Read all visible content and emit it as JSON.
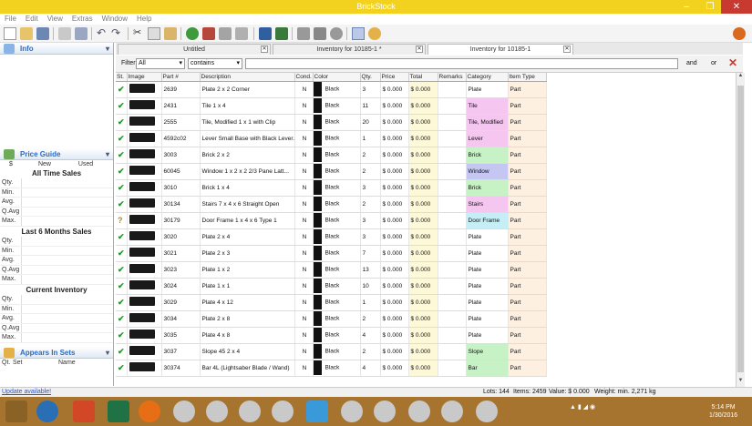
{
  "window": {
    "title": "BrickStock"
  },
  "menu": [
    "File",
    "Edit",
    "View",
    "Extras",
    "Window",
    "Help"
  ],
  "sidebar": {
    "info_title": "Info",
    "price_guide_title": "Price Guide",
    "price_cols": [
      "$",
      "New",
      "Used"
    ],
    "sections": [
      {
        "title": "All Time Sales",
        "rows": [
          "Qty.",
          "Min.",
          "Avg.",
          "Q.Avg",
          "Max."
        ]
      },
      {
        "title": "Last 6 Months Sales",
        "rows": [
          "Qty.",
          "Min.",
          "Avg.",
          "Q.Avg",
          "Max."
        ]
      },
      {
        "title": "Current Inventory",
        "rows": [
          "Qty.",
          "Min.",
          "Avg.",
          "Q.Avg",
          "Max."
        ]
      }
    ],
    "appears_title": "Appears In Sets",
    "appears_cols": [
      "Qt.",
      "Set",
      "Name"
    ]
  },
  "tabs": [
    {
      "label": "Untitled"
    },
    {
      "label": "Inventory for 10185-1 *"
    },
    {
      "label": "Inventory for 10185-1"
    }
  ],
  "filter": {
    "label": "Filter:",
    "field": "All",
    "mode": "contains",
    "value": "",
    "and": "and",
    "or": "or"
  },
  "columns": [
    "St.",
    "Image",
    "Part #",
    "Description",
    "Cond.",
    "Color",
    "Qty.",
    "Price",
    "Total",
    "Remarks",
    "Category",
    "Item Type"
  ],
  "rows": [
    {
      "status": "✔",
      "part": "2639",
      "desc": "Plate 2 x 2 Corner",
      "cond": "N",
      "color": "Black",
      "qty": "3",
      "price": "$ 0.000",
      "total": "$ 0.000",
      "category": "Plate",
      "cat_color": "#ffffff",
      "type": "Part"
    },
    {
      "status": "✔",
      "part": "2431",
      "desc": "Tile 1 x 4",
      "cond": "N",
      "color": "Black",
      "qty": "11",
      "price": "$ 0.000",
      "total": "$ 0.000",
      "category": "Tile",
      "cat_color": "#f4c6f0",
      "type": "Part"
    },
    {
      "status": "✔",
      "part": "2555",
      "desc": "Tile, Modified 1 x 1 with Clip",
      "cond": "N",
      "color": "Black",
      "qty": "20",
      "price": "$ 0.000",
      "total": "$ 0.000",
      "category": "Tile, Modified",
      "cat_color": "#f4c6f0",
      "type": "Part"
    },
    {
      "status": "✔",
      "part": "4592c02",
      "desc": "Lever Small Base with Black Lever...",
      "cond": "N",
      "color": "Black",
      "qty": "1",
      "price": "$ 0.000",
      "total": "$ 0.000",
      "category": "Lever",
      "cat_color": "#f4c6f0",
      "type": "Part"
    },
    {
      "status": "✔",
      "part": "3003",
      "desc": "Brick 2 x 2",
      "cond": "N",
      "color": "Black",
      "qty": "2",
      "price": "$ 0.000",
      "total": "$ 0.000",
      "category": "Brick",
      "cat_color": "#c6f2c6",
      "type": "Part"
    },
    {
      "status": "✔",
      "part": "60045",
      "desc": "Window 1 x 2 x 2 2/3 Pane Latt...",
      "cond": "N",
      "color": "Black",
      "qty": "2",
      "price": "$ 0.000",
      "total": "$ 0.000",
      "category": "Window",
      "cat_color": "#c6c6f2",
      "type": "Part"
    },
    {
      "status": "✔",
      "part": "3010",
      "desc": "Brick 1 x 4",
      "cond": "N",
      "color": "Black",
      "qty": "3",
      "price": "$ 0.000",
      "total": "$ 0.000",
      "category": "Brick",
      "cat_color": "#c6f2c6",
      "type": "Part"
    },
    {
      "status": "✔",
      "part": "30134",
      "desc": "Stairs 7 x 4 x 6 Straight Open",
      "cond": "N",
      "color": "Black",
      "qty": "2",
      "price": "$ 0.000",
      "total": "$ 0.000",
      "category": "Stairs",
      "cat_color": "#f4c6f0",
      "type": "Part"
    },
    {
      "status": "?",
      "part": "30179",
      "desc": "Door Frame 1 x 4 x 6 Type 1",
      "cond": "N",
      "color": "Black",
      "qty": "3",
      "price": "$ 0.000",
      "total": "$ 0.000",
      "category": "Door Frame",
      "cat_color": "#c6eef6",
      "type": "Part"
    },
    {
      "status": "✔",
      "part": "3020",
      "desc": "Plate 2 x 4",
      "cond": "N",
      "color": "Black",
      "qty": "3",
      "price": "$ 0.000",
      "total": "$ 0.000",
      "category": "Plate",
      "cat_color": "#ffffff",
      "type": "Part"
    },
    {
      "status": "✔",
      "part": "3021",
      "desc": "Plate 2 x 3",
      "cond": "N",
      "color": "Black",
      "qty": "7",
      "price": "$ 0.000",
      "total": "$ 0.000",
      "category": "Plate",
      "cat_color": "#ffffff",
      "type": "Part"
    },
    {
      "status": "✔",
      "part": "3023",
      "desc": "Plate 1 x 2",
      "cond": "N",
      "color": "Black",
      "qty": "13",
      "price": "$ 0.000",
      "total": "$ 0.000",
      "category": "Plate",
      "cat_color": "#ffffff",
      "type": "Part"
    },
    {
      "status": "✔",
      "part": "3024",
      "desc": "Plate 1 x 1",
      "cond": "N",
      "color": "Black",
      "qty": "10",
      "price": "$ 0.000",
      "total": "$ 0.000",
      "category": "Plate",
      "cat_color": "#ffffff",
      "type": "Part"
    },
    {
      "status": "✔",
      "part": "3029",
      "desc": "Plate 4 x 12",
      "cond": "N",
      "color": "Black",
      "qty": "1",
      "price": "$ 0.000",
      "total": "$ 0.000",
      "category": "Plate",
      "cat_color": "#ffffff",
      "type": "Part"
    },
    {
      "status": "✔",
      "part": "3034",
      "desc": "Plate 2 x 8",
      "cond": "N",
      "color": "Black",
      "qty": "2",
      "price": "$ 0.000",
      "total": "$ 0.000",
      "category": "Plate",
      "cat_color": "#ffffff",
      "type": "Part"
    },
    {
      "status": "✔",
      "part": "3035",
      "desc": "Plate 4 x 8",
      "cond": "N",
      "color": "Black",
      "qty": "4",
      "price": "$ 0.000",
      "total": "$ 0.000",
      "category": "Plate",
      "cat_color": "#ffffff",
      "type": "Part"
    },
    {
      "status": "✔",
      "part": "3037",
      "desc": "Slope 45 2 x 4",
      "cond": "N",
      "color": "Black",
      "qty": "2",
      "price": "$ 0.000",
      "total": "$ 0.000",
      "category": "Slope",
      "cat_color": "#c6f2c6",
      "type": "Part"
    },
    {
      "status": "✔",
      "part": "30374",
      "desc": "Bar 4L (Lightsaber Blade / Wand)",
      "cond": "N",
      "color": "Black",
      "qty": "4",
      "price": "$ 0.000",
      "total": "$ 0.000",
      "category": "Bar",
      "cat_color": "#c6f2c6",
      "type": "Part"
    }
  ],
  "status": {
    "left": "Update available!",
    "lots": "Lots: 144",
    "items": "Items: 2459",
    "value": "Value: $ 0.000",
    "weight": "Weight: min. 2,271 kg"
  },
  "clock": {
    "time": "5:14 PM",
    "date": "1/30/2016"
  }
}
